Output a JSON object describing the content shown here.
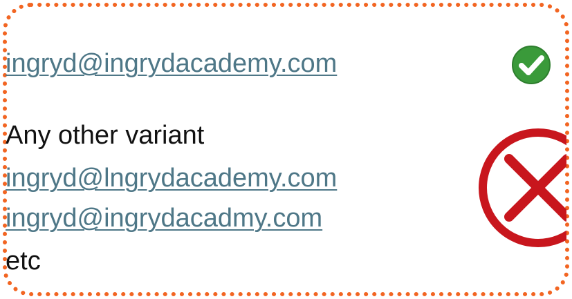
{
  "approved": {
    "email": "ingryd@ingrydacademy.com",
    "icon": "check-circle-icon",
    "icon_color": "#3a9a3a"
  },
  "rejected": {
    "heading": "Any other variant",
    "variants": [
      "ingryd@lngrydacademy.com",
      "ingryd@ingrydacadmy.com"
    ],
    "footer": "etc",
    "icon": "cross-circle-icon",
    "icon_color": "#c8161d"
  },
  "colors": {
    "border": "#f26522",
    "link": "#4e7787",
    "text": "#111111"
  }
}
